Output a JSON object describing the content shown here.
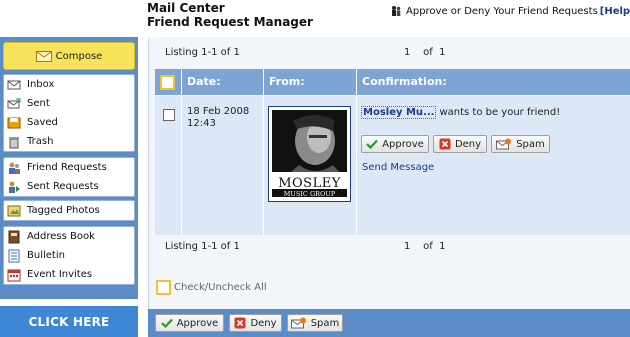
{
  "header": {
    "title": "Mail Center",
    "subtitle": "Friend Request Manager",
    "right_text": "Approve or Deny Your Friend Requests",
    "help_link": "[Help"
  },
  "sidebar": {
    "compose_label": "Compose",
    "items": [
      {
        "label": "Inbox",
        "icon": "inbox-icon"
      },
      {
        "label": "Sent",
        "icon": "sent-icon"
      },
      {
        "label": "Saved",
        "icon": "saved-icon"
      },
      {
        "label": "Trash",
        "icon": "trash-icon"
      },
      {
        "label": "Friend Requests",
        "icon": "friend-requests-icon"
      },
      {
        "label": "Sent Requests",
        "icon": "sent-requests-icon"
      },
      {
        "label": "Tagged Photos",
        "icon": "tagged-photos-icon"
      },
      {
        "label": "Address Book",
        "icon": "address-book-icon"
      },
      {
        "label": "Bulletin",
        "icon": "bulletin-icon"
      },
      {
        "label": "Event Invites",
        "icon": "event-invites-icon"
      }
    ],
    "banner_label": "CLICK HERE"
  },
  "listing": {
    "top_text": "Listing 1-1 of 1",
    "top_page": "1",
    "top_of": "of",
    "top_total": "1",
    "bottom_text": "Listing 1-1 of 1",
    "bottom_page": "1",
    "bottom_of": "of",
    "bottom_total": "1"
  },
  "table": {
    "columns": [
      "Date:",
      "From:",
      "Confirmation:"
    ],
    "rows": [
      {
        "date_line1": "18 Feb 2008",
        "date_line2": "12:43",
        "photo_text_big": "MOSLEY",
        "photo_text_small": "MUSIC GROUP",
        "sender_name": "Mosley Mu...",
        "message": "wants to be your friend!",
        "approve_label": "Approve",
        "deny_label": "Deny",
        "spam_label": "Spam",
        "send_message_label": "Send Message"
      }
    ]
  },
  "footer": {
    "check_all_label": "Check/Uncheck All",
    "approve_label": "Approve",
    "deny_label": "Deny",
    "spam_label": "Spam"
  },
  "colors": {
    "sidebar_blue": "#5b8cc5",
    "table_header_blue": "#7ea4d4",
    "row_bg": "#dde8f6",
    "compose_yellow": "#f7e45a",
    "link_blue": "#1d3a8a",
    "check_yellow": "#f0c23a"
  }
}
